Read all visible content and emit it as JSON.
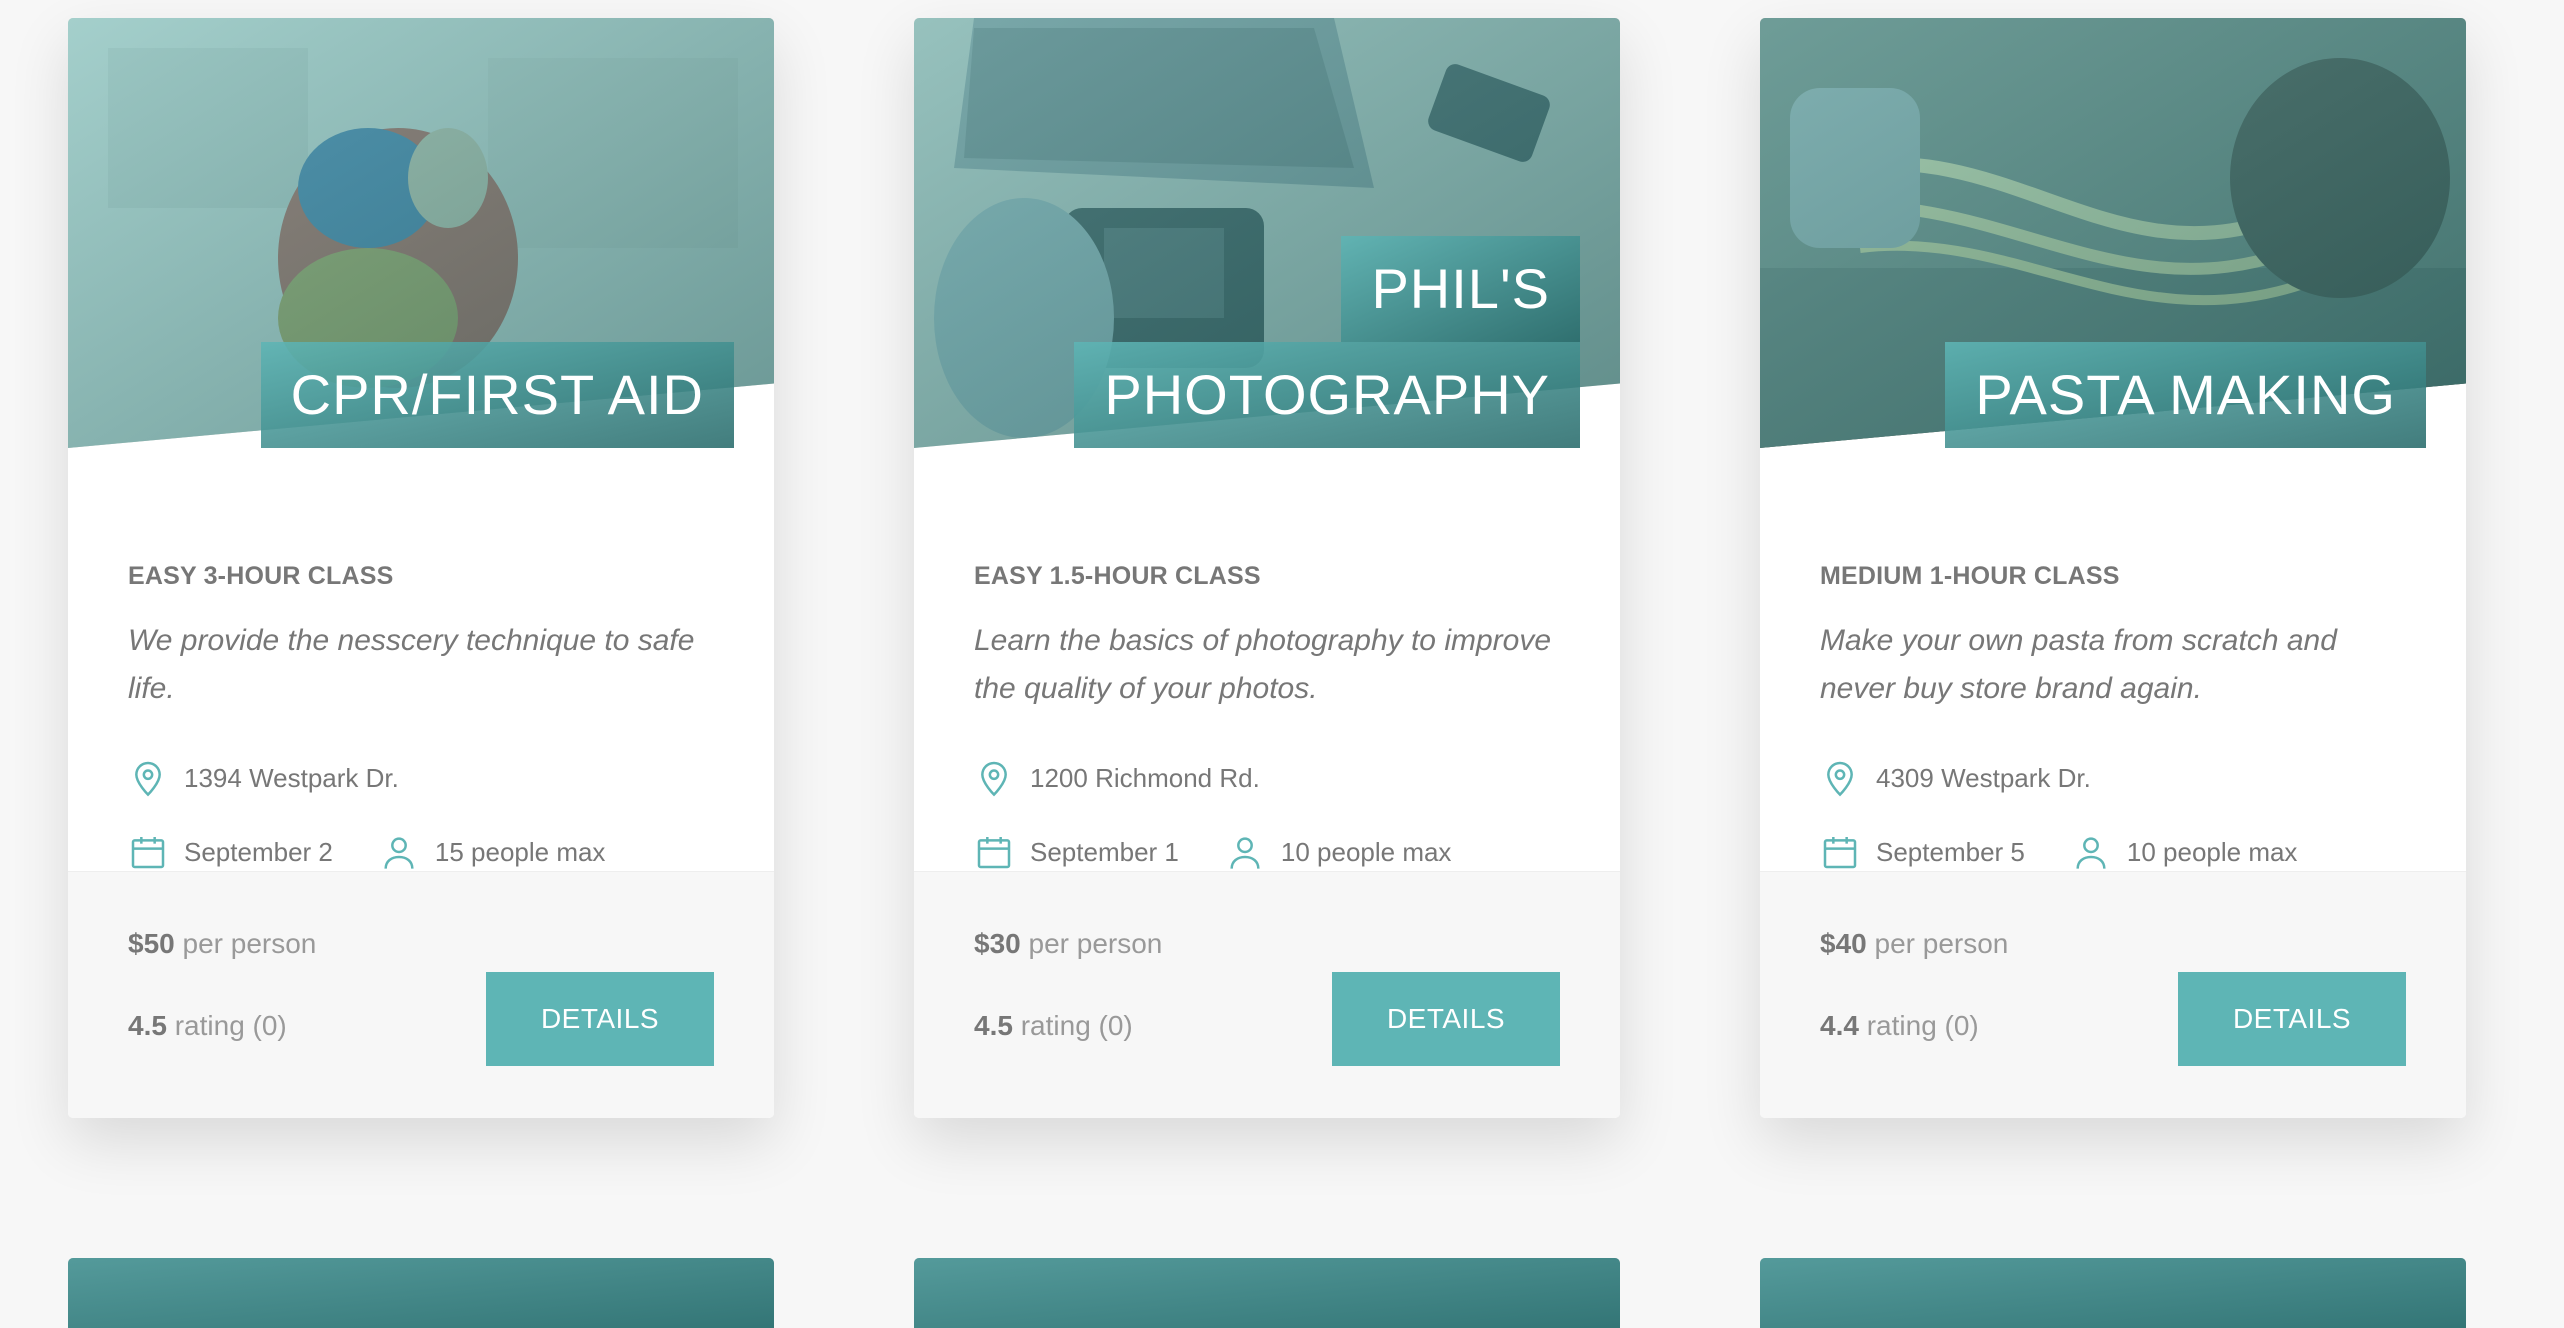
{
  "cards": [
    {
      "heading_line1": "CPR/FIRST AID",
      "heading_line2": "",
      "subtitle": "EASY 3-HOUR CLASS",
      "description": "We provide the nesscery technique to safe life.",
      "location": "1394 Westpark Dr.",
      "date": "September 2",
      "capacity": "15 people max",
      "price": "$50",
      "price_suffix": "per person",
      "rating_value": "4.5",
      "rating_suffix": "rating (0)",
      "button": "DETAILS"
    },
    {
      "heading_line1": "PHIL'S",
      "heading_line2": "PHOTOGRAPHY",
      "subtitle": "EASY 1.5-HOUR CLASS",
      "description": "Learn the basics of photography to improve the quality of your photos.",
      "location": "1200 Richmond Rd.",
      "date": "September 1",
      "capacity": "10 people max",
      "price": "$30",
      "price_suffix": "per person",
      "rating_value": "4.5",
      "rating_suffix": "rating (0)",
      "button": "DETAILS"
    },
    {
      "heading_line1": "PASTA MAKING",
      "heading_line2": "",
      "subtitle": "MEDIUM 1-HOUR CLASS",
      "description": "Make your own pasta from scratch and never buy store brand again.",
      "location": "4309 Westpark Dr.",
      "date": "September 5",
      "capacity": "10 people max",
      "price": "$40",
      "price_suffix": "per person",
      "rating_value": "4.4",
      "rating_suffix": "rating (0)",
      "button": "DETAILS"
    }
  ],
  "colors": {
    "accent": "#5eb5b5",
    "accent_dark": "#286b6b",
    "background": "#f7f7f7",
    "text": "#777777"
  },
  "icons": [
    "location-pin-icon",
    "calendar-icon",
    "user-icon"
  ]
}
